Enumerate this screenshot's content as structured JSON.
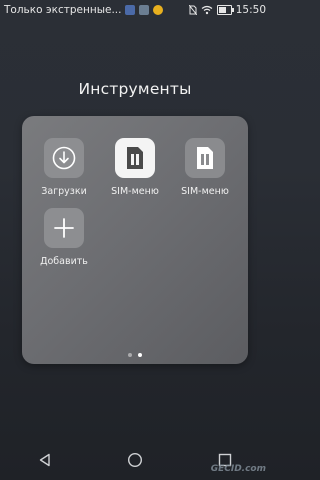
{
  "status_bar": {
    "carrier_text": "Только экстренные...",
    "time": "15:50",
    "battery_level": 0.7
  },
  "folder": {
    "title": "Инструменты",
    "apps": [
      {
        "label": "Загрузки",
        "icon": "download-icon"
      },
      {
        "label": "SIM-меню",
        "icon": "sim-card-icon"
      },
      {
        "label": "SIM-меню",
        "icon": "sim-card-icon"
      },
      {
        "label": "Добавить",
        "icon": "plus-icon"
      }
    ],
    "pages": 2,
    "current_page": 2
  },
  "navigation": {
    "back": "back-triangle-icon",
    "home": "home-circle-icon",
    "recents": "recents-square-icon"
  },
  "watermark": "GECID.com"
}
